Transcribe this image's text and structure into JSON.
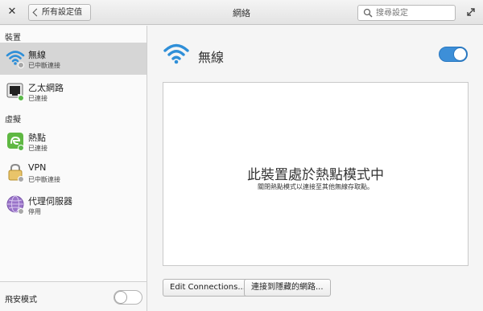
{
  "header": {
    "back_label": "所有設定值",
    "title": "網絡",
    "search_placeholder": "搜尋設定"
  },
  "sidebar": {
    "section_devices": "裝置",
    "section_virtual": "虛擬",
    "items": [
      {
        "name": "無線",
        "status": "已中斷連接",
        "icon": "wifi-icon",
        "status_color": "grey",
        "selected": true
      },
      {
        "name": "乙太網路",
        "status": "已連接",
        "icon": "ethernet-icon",
        "status_color": "green"
      },
      {
        "name": "熱點",
        "status": "已連接",
        "icon": "hotspot-icon",
        "status_color": "green"
      },
      {
        "name": "VPN",
        "status": "已中斷連接",
        "icon": "lock-icon",
        "status_color": "grey"
      },
      {
        "name": "代理伺服器",
        "status": "停用",
        "icon": "proxy-globe-icon",
        "status_color": "grey"
      }
    ],
    "airplane_label": "飛安模式",
    "airplane_on": false
  },
  "main": {
    "title": "無線",
    "wireless_on": true,
    "hotspot_title": "此裝置處於熱點模式中",
    "hotspot_subtitle": "關閉熱點模式以連接至其他無線存取點。",
    "edit_button": "Edit Connections...",
    "hidden_button": "連接到隱藏的網路..."
  },
  "colors": {
    "accent": "#3d8fd8",
    "connected": "#5bb94a",
    "disconnected": "#a8a8a8"
  }
}
